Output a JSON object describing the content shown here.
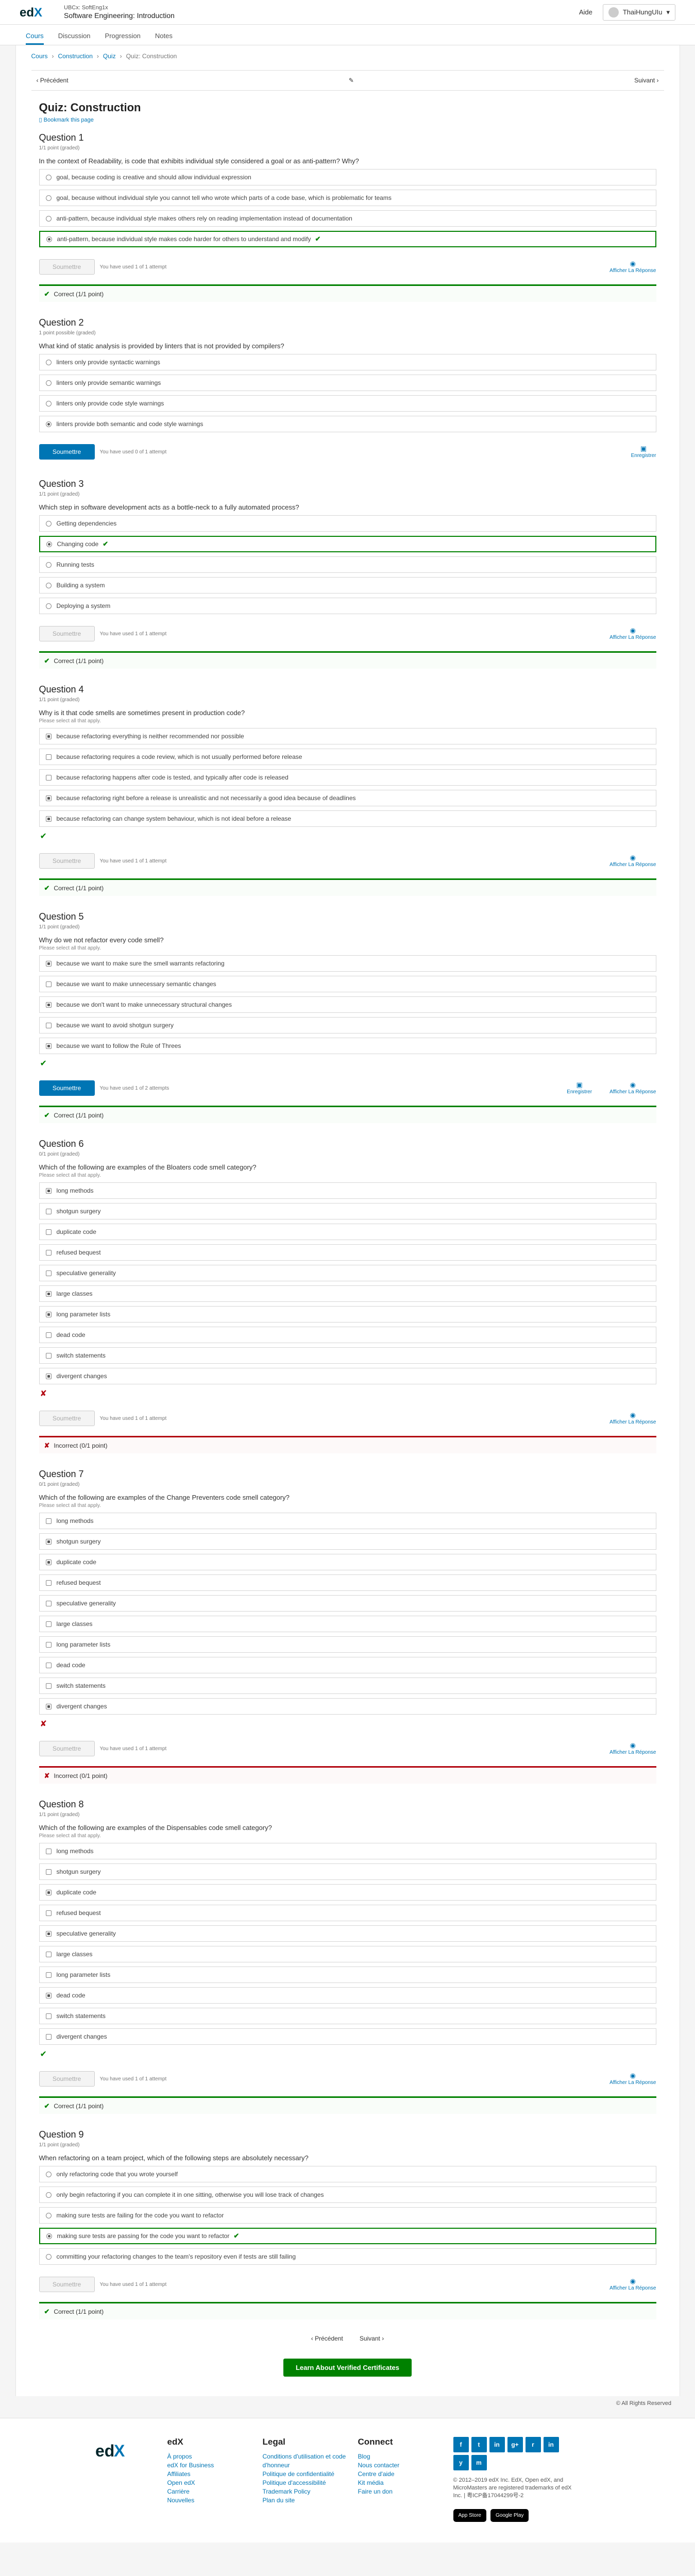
{
  "header": {
    "logo": "edX",
    "org": "UBCx: SoftEng1x",
    "course": "Software Engineering: Introduction",
    "help": "Aide",
    "user": "ThaiHungUIu"
  },
  "tabs": [
    "Cours",
    "Discussion",
    "Progression",
    "Notes"
  ],
  "breadcrumb": [
    "Cours",
    "Construction",
    "Quiz",
    "Quiz: Construction"
  ],
  "seqnav": {
    "prev": "Précédent",
    "next": "Suivant"
  },
  "unit_title": "Quiz: Construction",
  "bookmark": "Bookmark this page",
  "q1": {
    "title": "Question 1",
    "points": "1/1 point (graded)",
    "question": "In the context of Readability, is code that exhibits individual style considered a goal or as anti-pattern? Why?",
    "choices": [
      "goal, because coding is creative and should allow individual expression",
      "goal, because without individual style you cannot tell who wrote which parts of a code base, which is problematic for teams",
      "anti-pattern, because individual style makes others rely on reading implementation instead of documentation",
      "anti-pattern, because individual style makes code harder for others to understand and modify"
    ],
    "submit": "Soumettre",
    "attempts": "You have used 1 of 1 attempt",
    "tool": "Afficher La Réponse",
    "status": "Correct (1/1 point)"
  },
  "q2": {
    "title": "Question 2",
    "points": "1 point possible (graded)",
    "question": "What kind of static analysis is provided by linters that is not provided by compilers?",
    "choices": [
      "linters only provide syntactic warnings",
      "linters only provide semantic warnings",
      "linters only provide code style warnings",
      "linters provide both semantic and code style warnings"
    ],
    "submit": "Soumettre",
    "attempts": "You have used 0 of 1 attempt",
    "tool": "Enregistrer"
  },
  "q3": {
    "title": "Question 3",
    "points": "1/1 point (graded)",
    "question": "Which step in software development acts as a bottle-neck to a fully automated process?",
    "choices": [
      "Getting dependencies",
      "Changing code",
      "Running tests",
      "Building a system",
      "Deploying a system"
    ],
    "submit": "Soumettre",
    "attempts": "You have used 1 of 1 attempt",
    "tool": "Afficher La Réponse",
    "status": "Correct (1/1 point)"
  },
  "q4": {
    "title": "Question 4",
    "points": "1/1 point (graded)",
    "question": "Why is it that code smells are sometimes present in production code?",
    "select": "Please select all that apply.",
    "choices": [
      "because refactoring everything is neither recommended nor possible",
      "because refactoring requires a code review, which is not usually performed before release",
      "because refactoring happens after code is tested, and typically after code is released",
      "because refactoring right before a release is unrealistic and not necessarily a good idea because of deadlines",
      "because refactoring can change system behaviour, which is not ideal before a release"
    ],
    "submit": "Soumettre",
    "attempts": "You have used 1 of 1 attempt",
    "tool": "Afficher La Réponse",
    "status": "Correct (1/1 point)"
  },
  "q5": {
    "title": "Question 5",
    "points": "1/1 point (graded)",
    "question": "Why do we not refactor every code smell?",
    "select": "Please select all that apply.",
    "choices": [
      "because we want to make sure the smell warrants refactoring",
      "because we want to make unnecessary semantic changes",
      "because we don't want to make unnecessary structural changes",
      "because we want to avoid shotgun surgery",
      "because we want to follow the Rule of Threes"
    ],
    "submit": "Soumettre",
    "attempts": "You have used 1 of 2 attempts",
    "tool1": "Enregistrer",
    "tool2": "Afficher La Réponse",
    "status": "Correct (1/1 point)"
  },
  "q6": {
    "title": "Question 6",
    "points": "0/1 point (graded)",
    "question": "Which of the following are examples of the Bloaters code smell category?",
    "select": "Please select all that apply.",
    "choices": [
      "long methods",
      "shotgun surgery",
      "duplicate code",
      "refused bequest",
      "speculative generality",
      "large classes",
      "long parameter lists",
      "dead code",
      "switch statements",
      "divergent changes"
    ],
    "submit": "Soumettre",
    "attempts": "You have used 1 of 1 attempt",
    "tool": "Afficher La Réponse",
    "status": "Incorrect (0/1 point)"
  },
  "q7": {
    "title": "Question 7",
    "points": "0/1 point (graded)",
    "question": "Which of the following are examples of the Change Preventers code smell category?",
    "select": "Please select all that apply.",
    "choices": [
      "long methods",
      "shotgun surgery",
      "duplicate code",
      "refused bequest",
      "speculative generality",
      "large classes",
      "long parameter lists",
      "dead code",
      "switch statements",
      "divergent changes"
    ],
    "submit": "Soumettre",
    "attempts": "You have used 1 of 1 attempt",
    "tool": "Afficher La Réponse",
    "status": "Incorrect (0/1 point)"
  },
  "q8": {
    "title": "Question 8",
    "points": "1/1 point (graded)",
    "question": "Which of the following are examples of the Dispensables code smell category?",
    "select": "Please select all that apply.",
    "choices": [
      "long methods",
      "shotgun surgery",
      "duplicate code",
      "refused bequest",
      "speculative generality",
      "large classes",
      "long parameter lists",
      "dead code",
      "switch statements",
      "divergent changes"
    ],
    "submit": "Soumettre",
    "attempts": "You have used 1 of 1 attempt",
    "tool": "Afficher La Réponse",
    "status": "Correct (1/1 point)"
  },
  "q9": {
    "title": "Question 9",
    "points": "1/1 point (graded)",
    "question": "When refactoring on a team project, which of the following steps are absolutely necessary?",
    "choices": [
      "only refactoring code that you wrote yourself",
      "only begin refactoring if you can complete it in one sitting, otherwise you will lose track of changes",
      "making sure tests are failing for the code you want to refactor",
      "making sure tests are passing for the code you want to refactor",
      "committing your refactoring changes to the team's repository even if tests are still failing"
    ],
    "submit": "Soumettre",
    "attempts": "You have used 1 of 1 attempt",
    "tool": "Afficher La Réponse",
    "status": "Correct (1/1 point)"
  },
  "bottom_nav": {
    "prev": "Précédent",
    "next": "Suivant"
  },
  "certificate": "Learn About Verified Certificates",
  "rights": "© All Rights Reserved",
  "footer": {
    "logo": "edX",
    "col1": {
      "title": "edX",
      "links": [
        "À propos",
        "edX for Business",
        "Affiliates",
        "Open edX",
        "Carrière",
        "Nouvelles"
      ]
    },
    "col2": {
      "title": "Legal",
      "links": [
        "Conditions d'utilisation et code d'honneur",
        "Politique de confidentialité",
        "Politique d'accessibilité",
        "Trademark Policy",
        "Plan du site"
      ]
    },
    "col3": {
      "title": "Connect",
      "links": [
        "Blog",
        "Nous contacter",
        "Centre d'aide",
        "Kit média",
        "Faire un don"
      ]
    },
    "social": [
      "f",
      "t",
      "in",
      "g+",
      "r",
      "in",
      "y",
      "m"
    ],
    "copyright": "© 2012–2019 edX Inc. EdX, Open edX, and MicroMasters are registered trademarks of edX Inc. | 粤ICP备17044299号-2",
    "stores": [
      "App Store",
      "Google Play"
    ]
  }
}
